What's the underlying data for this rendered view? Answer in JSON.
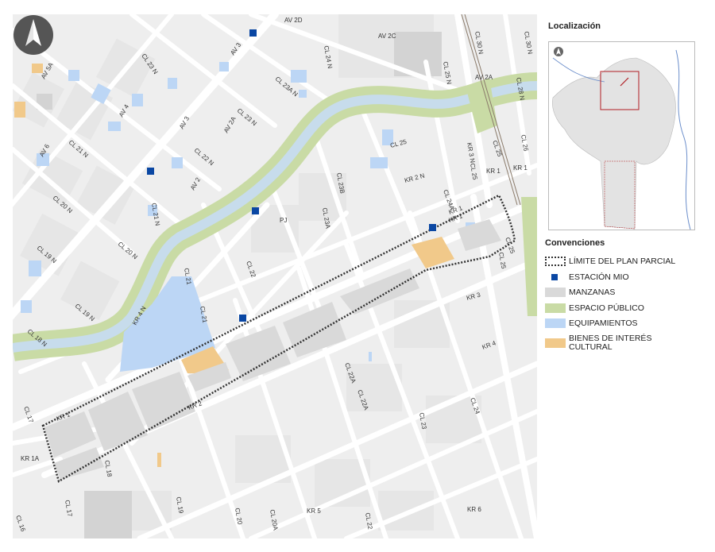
{
  "localization": {
    "title": "Localización"
  },
  "legend": {
    "title": "Convenciones",
    "items": [
      {
        "label": "LÍMITE DEL PLAN PARCIAL",
        "symbol": "boundary-symbol",
        "color": "#333333"
      },
      {
        "label": "ESTACIÓN MIO",
        "symbol": "station-symbol",
        "color": "#0a47a3"
      },
      {
        "label": "MANZANAS",
        "symbol": "block-symbol",
        "color": "#d9d9d9"
      },
      {
        "label": "ESPACIO PÚBLICO",
        "symbol": "public-space-symbol",
        "color": "#c9dba5"
      },
      {
        "label": "EQUIPAMIENTOS",
        "symbol": "facility-symbol",
        "color": "#bcd6f5"
      },
      {
        "label": "BIENES DE INTERÉS CULTURAL",
        "symbol": "heritage-symbol",
        "color": "#f1c98a"
      }
    ]
  },
  "map": {
    "north_icon": "north-arrow-icon",
    "colors": {
      "background": "#eeeeee",
      "street": "#ffffff",
      "river": "#c7dcec",
      "river_bank": "#c9dba5",
      "block": "#d9d9d9",
      "facility": "#bcd6f5",
      "heritage": "#f1c98a",
      "station": "#0a47a3",
      "boundary": "#333333",
      "railway": "#8a7a6a"
    },
    "street_labels": [
      "AV 5B",
      "AV 3",
      "AV 2D",
      "AV 2C",
      "CL 24 N",
      "CL 23 N",
      "AV 5A",
      "CL 23A N",
      "CL 25 N",
      "CL 30 N",
      "CL 30 N",
      "AV 2A",
      "CL 28 N",
      "AV 4",
      "CL 23 N",
      "AV 3",
      "AV 2A",
      "CL 21 N",
      "CL 22 N",
      "AV 6",
      "CL 26",
      "CL 25",
      "KR 3 N",
      "CL 25",
      "CL 25",
      "KR 1",
      "KR 1",
      "CL 23B",
      "KR 2 N",
      "CL 20 N",
      "AV 2",
      "CL 21 N",
      "CL 24A",
      "CL 23A",
      "PJ",
      "KR 1",
      "KR 1",
      "CL 19 N",
      "CL 20 N",
      "CL 25",
      "CL 25",
      "CL 21",
      "CL 22",
      "KR 3",
      "CL 19 N",
      "KR 4 N",
      "CL 21",
      "CL 18 N",
      "KR 4",
      "CL 22A",
      "CL 22A",
      "KR 2",
      "CL 24",
      "CL 17",
      "KR 1",
      "CL 23",
      "KR 1A",
      "CL 18",
      "CL 19",
      "CL 20",
      "CL 20A",
      "KR 5",
      "CL 22",
      "KR 6",
      "CL 17",
      "CL 16"
    ]
  }
}
